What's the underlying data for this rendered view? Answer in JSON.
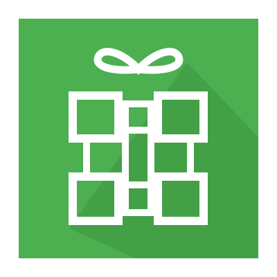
{
  "app_icon": {
    "name": "gift-icon",
    "background_color": "#4caf50",
    "shadow_color": "#43a047",
    "glyph_color": "#ffffff"
  }
}
